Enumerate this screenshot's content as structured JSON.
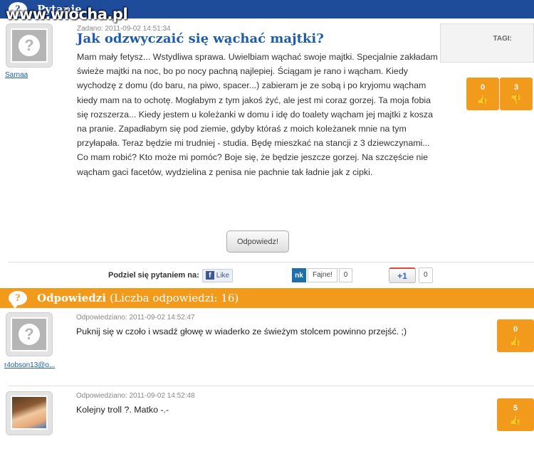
{
  "watermark": "www.wiocha.pl",
  "question_header": {
    "title": "Pytanie"
  },
  "question": {
    "meta": "Zadano: 2011-09-02 14:51:34",
    "title": "Jak odzwyczaić się wąchać majtki?",
    "body": "Mam mały fetysz... Wstydliwa sprawa. Uwielbiam wąchać swoje majtki. Specjalnie zakładam świeże majtki na noc, bo po nocy pachną najlepiej. Ściągam je rano i wącham. Kiedy wychodzę z domu (do baru, na piwo, spacer...) zabieram je ze sobą i po kryjomu wącham kiedy mam na to ochotę. Mogłabym z tym jakoś żyć, ale jest mi coraz gorzej. Ta moja fobia się rozszerza... Kiedy jestem u koleżanki w domu i idę do toalety wącham jej majtki z kosza na pranie. Zapadłabym się pod ziemie, gdyby któraś z moich koleżanek mnie na tym przyłapała. Teraz będzie mi trudniej - studia. Będę mieszkać na stancji z 3 dziewczynami... Co mam robić? Kto może mi pomóc? Boje się, że będzie jeszcze gorzej. Na szczęście nie wącham gaci facetów, wydzielina z penisa nie pachnie tak ładnie jak z cipki.",
    "author": "Sarnaa",
    "votes_up": "0",
    "votes_down": "3",
    "reply_button": "Odpowiedz!"
  },
  "tags": {
    "label": "TAGI:"
  },
  "share": {
    "label": "Podziel się pytaniem na:",
    "fb_label": "Like",
    "nk_logo": "nk",
    "nk_label": "Fajne!",
    "nk_count": "0",
    "gplus_label": "+1",
    "gplus_count": "0"
  },
  "answers_header": {
    "title": "Odpowiedzi",
    "count_label": "(Liczba odpowiedzi: 16)"
  },
  "answers": [
    {
      "meta": "Odpowiedziano: 2011-09-02 14:52:47",
      "text": "Puknij się w czoło i wsadź głowę w wiaderko ze świeżym stolcem powinno przejść. ;)",
      "author": "r4obson13@o...",
      "votes": "0"
    },
    {
      "meta": "Odpowiedziano: 2011-09-02 14:52:48",
      "text": "Kolejny troll ?. Matko -.-",
      "author": "",
      "votes": "5"
    }
  ],
  "icons": {
    "thumb_up": "thumbs-up-icon",
    "thumb_down": "thumbs-down-icon",
    "question": "question-bubble-icon"
  },
  "colors": {
    "blue_bar": "#1e4b9a",
    "orange_bar": "#f29a1b",
    "link": "#1e5ba8"
  }
}
